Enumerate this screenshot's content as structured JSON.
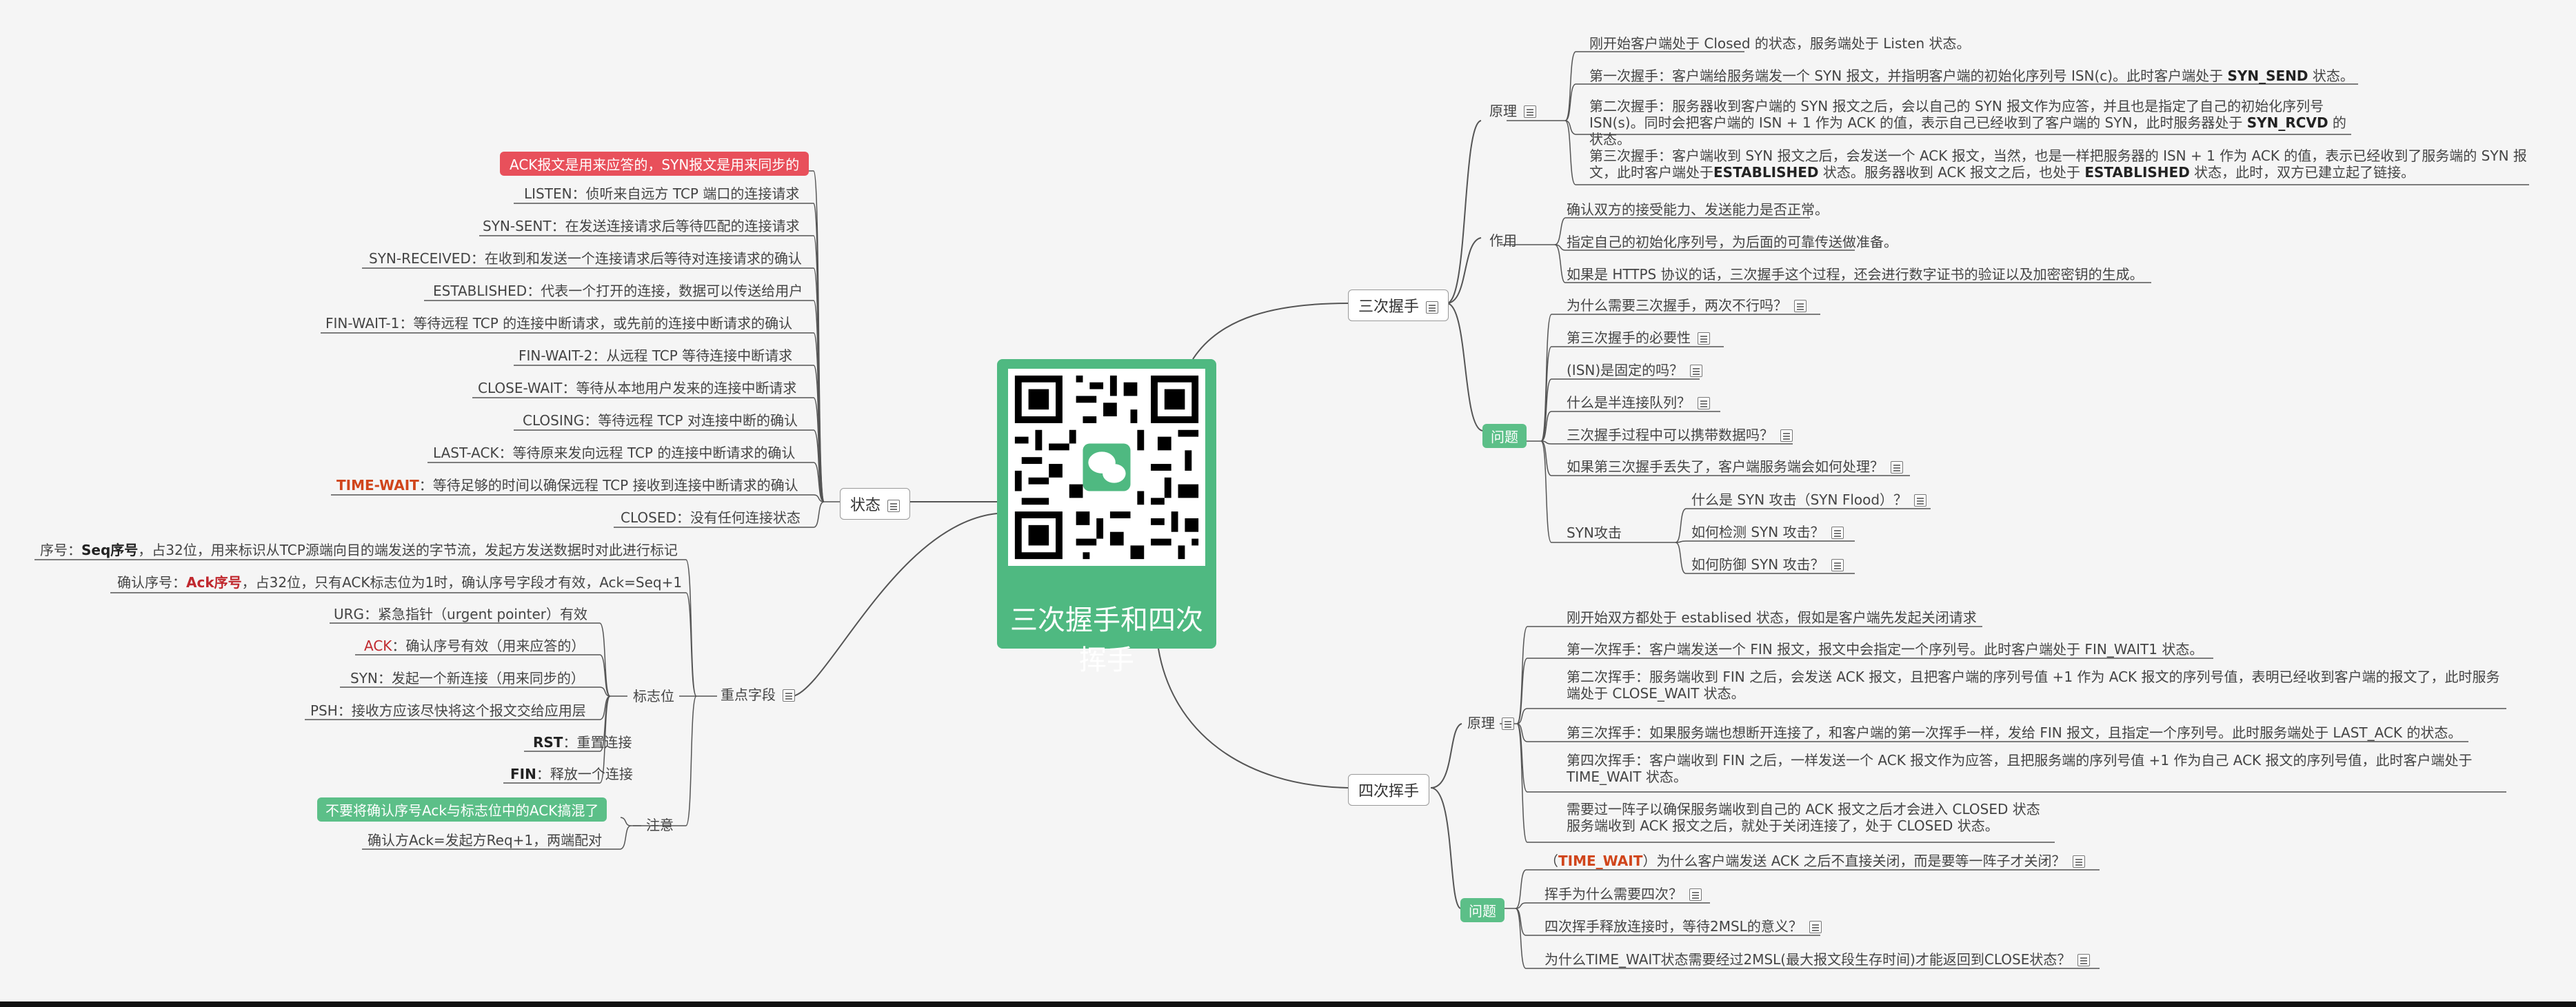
{
  "center": {
    "title": "三次握手和四次挥手",
    "qr_icon": "wechat-qr-code"
  },
  "branches": {
    "handshake": "三次握手",
    "wave": "四次挥手",
    "state": "状态",
    "key_fields": "重点字段"
  },
  "handshake": {
    "principle": {
      "label": "原理",
      "items": [
        "刚开始客户端处于 Closed 的状态，服务端处于 Listen 状态。",
        "第一次握手：客户端给服务端发一个 SYN 报文，并指明客户端的初始化序列号 ISN(c)。此时客户端处于 SYN_SEND 状态。",
        "第二次握手：服务器收到客户端的 SYN 报文之后，会以自己的 SYN 报文作为应答，并且也是指定了自己的初始化序列号 ISN(s)。同时会把客户端的 ISN + 1 作为 ACK 的值，表示自己已经收到了客户端的 SYN，此时服务器处于 SYN_RCVD 的状态。",
        "第三次握手：客户端收到 SYN 报文之后，会发送一个 ACK 报文，当然，也是一样把服务器的 ISN + 1 作为 ACK 的值，表示已经收到了服务端的 SYN 报文，此时客户端处于ESTABLISHED 状态。服务器收到 ACK 报文之后，也处于 ESTABLISHED 状态，此时，双方已建立起了链接。"
      ]
    },
    "role": {
      "label": "作用",
      "items": [
        "确认双方的接受能力、发送能力是否正常。",
        "指定自己的初始化序列号，为后面的可靠传送做准备。",
        "如果是 HTTPS 协议的话，三次握手这个过程，还会进行数字证书的验证以及加密密钥的生成。"
      ]
    },
    "questions": {
      "label": "问题",
      "items": [
        "为什么需要三次握手，两次不行吗？",
        "第三次握手的必要性",
        "(ISN)是固定的吗？",
        "什么是半连接队列？",
        "三次握手过程中可以携带数据吗？",
        "如果第三次握手丢失了，客户端服务端会如何处理？"
      ],
      "syn_attack": {
        "label": "SYN攻击",
        "items": [
          "什么是 SYN 攻击（SYN Flood）？",
          "如何检测 SYN 攻击？",
          "如何防御 SYN 攻击？"
        ]
      }
    }
  },
  "wave": {
    "principle": {
      "label": "原理",
      "items": [
        "刚开始双方都处于 establised 状态，假如是客户端先发起关闭请求",
        "第一次挥手：客户端发送一个 FIN 报文，报文中会指定一个序列号。此时客户端处于 FIN_WAIT1 状态。",
        "第二次挥手：服务端收到 FIN 之后，会发送 ACK 报文，且把客户端的序列号值 +1 作为 ACK 报文的序列号值，表明已经收到客户端的报文了，此时服务端处于 CLOSE_WAIT 状态。",
        "第三次挥手：如果服务端也想断开连接了，和客户端的第一次挥手一样，发给 FIN 报文，且指定一个序列号。此时服务端处于 LAST_ACK 的状态。",
        "第四次挥手：客户端收到 FIN 之后，一样发送一个 ACK 报文作为应答，且把服务端的序列号值 +1 作为自己 ACK 报文的序列号值，此时客户端处于 TIME_WAIT 状态。",
        "需要过一阵子以确保服务端收到自己的 ACK 报文之后才会进入 CLOSED 状态 服务端收到 ACK 报文之后，就处于关闭连接了，处于 CLOSED 状态。"
      ]
    },
    "questions": {
      "label": "问题",
      "items": [
        "（TIME_WAIT）为什么客户端发送 ACK 之后不直接关闭，而是要等一阵子才关闭？",
        "挥手为什么需要四次？",
        "四次挥手释放连接时，等待2MSL的意义？",
        "为什么TIME_WAIT状态需要经过2MSL(最大报文段生存时间)才能返回到CLOSE状态？"
      ]
    }
  },
  "state": {
    "banner": "ACK报文是用来应答的，SYN报文是用来同步的",
    "items": [
      "LISTEN：侦听来自远方 TCP 端口的连接请求",
      "SYN-SENT：在发送连接请求后等待匹配的连接请求",
      "SYN-RECEIVED：在收到和发送一个连接请求后等待对连接请求的确认",
      "ESTABLISHED：代表一个打开的连接，数据可以传送给用户",
      "FIN-WAIT-1：等待远程 TCP 的连接中断请求，或先前的连接中断请求的确认",
      "FIN-WAIT-2：从远程 TCP 等待连接中断请求",
      "CLOSE-WAIT：等待从本地用户发来的连接中断请求",
      "CLOSING：等待远程 TCP 对连接中断的确认",
      "LAST-ACK：等待原来发向远程 TCP 的连接中断请求的确认",
      "：等待足够的时间以确保远程 TCP 接收到连接中断请求的确认",
      "CLOSED：没有任何连接状态"
    ],
    "time_wait_key": "TIME-WAIT"
  },
  "key_fields": {
    "seq": {
      "prefix": "序号：",
      "key": "Seq序号",
      "text": "，占32位，用来标识从TCP源端向目的端发送的字节流，发起方发送数据时对此进行标记"
    },
    "ack": {
      "prefix": "确认序号：",
      "key": "Ack序号",
      "text": "，占32位，只有ACK标志位为1时，确认序号字段才有效，Ack=Seq+1"
    },
    "flags": {
      "label": "标志位",
      "urg": "URG：紧急指针（urgent pointer）有效",
      "ack_key": "ACK",
      "ack_text": "：确认序号有效（用来应答的）",
      "syn": "SYN：发起一个新连接（用来同步的）",
      "psh": "PSH：接收方应该尽快将这个报文交给应用层",
      "rst_key": "RST",
      "rst_text": "：重置连接",
      "fin_key": "FIN",
      "fin_text": "：释放一个连接"
    },
    "notes": {
      "label": "注意",
      "warning": "不要将确认序号Ack与标志位中的ACK搞混了",
      "match": "确认方Ack=发起方Req+1，两端配对"
    }
  },
  "colors": {
    "accent_green": "#4fb981",
    "accent_red": "#e8505b",
    "highlight": "#d0451b"
  }
}
